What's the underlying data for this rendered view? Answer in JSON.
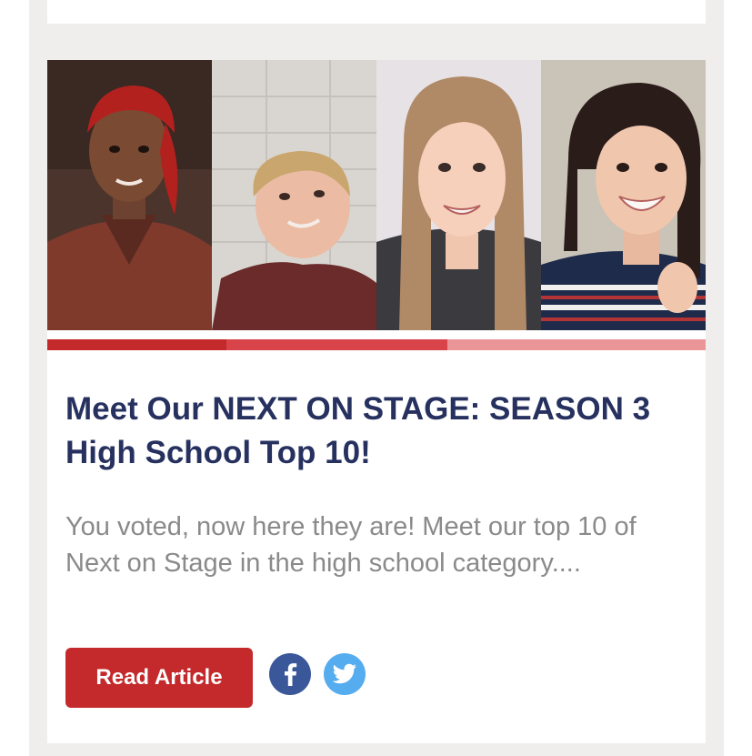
{
  "article": {
    "title": "Meet Our NEXT ON STAGE: SEASON 3 High School Top 10!",
    "excerpt": "You voted, now here they are! Meet our top 10 of Next on Stage in the high school category....",
    "read_button_label": "Read Article"
  },
  "social": {
    "facebook_icon": "facebook-icon",
    "twitter_icon": "twitter-icon"
  },
  "colors": {
    "title": "#27315f",
    "excerpt": "#8a8a8a",
    "button": "#c42a2c",
    "facebook": "#3a579a",
    "twitter": "#55acee",
    "accent_1": "#c42a2c",
    "accent_2": "#d9444a",
    "accent_3": "#ea9699",
    "background": "#efeeec"
  }
}
